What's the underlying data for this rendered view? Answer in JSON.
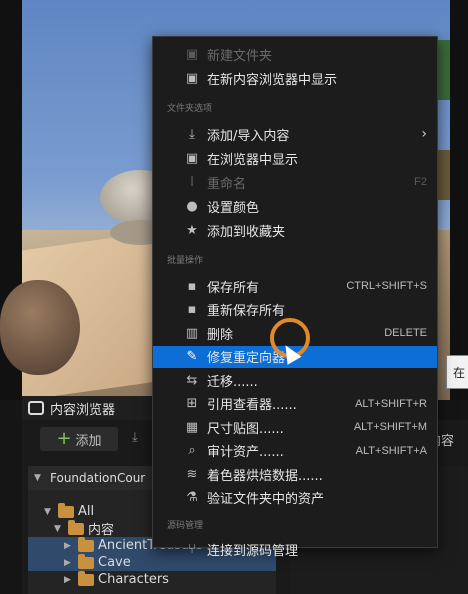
{
  "menu": {
    "top_items": [
      {
        "icon": "new-folder-icon",
        "label": "新建文件夹",
        "disabled": true
      },
      {
        "icon": "show-in-browser-icon",
        "label": "在新内容浏览器中显示",
        "disabled": false
      }
    ],
    "section_folder": "文件夹选项",
    "folder_items": [
      {
        "icon": "import-icon",
        "label": "添加/导入内容",
        "submenu": true
      },
      {
        "icon": "show-in-explorer-icon",
        "label": "在浏览器中显示"
      },
      {
        "icon": "rename-icon",
        "label": "重命名",
        "shortcut": "F2",
        "disabled": true
      },
      {
        "icon": "palette-icon",
        "label": "设置颜色"
      },
      {
        "icon": "star-icon",
        "label": "添加到收藏夹"
      }
    ],
    "section_bulk": "批量操作",
    "bulk_items": [
      {
        "icon": "save-icon",
        "label": "保存所有",
        "shortcut": "CTRL+SHIFT+S"
      },
      {
        "icon": "resave-icon",
        "label": "重新保存所有"
      },
      {
        "icon": "trash-icon",
        "label": "删除",
        "shortcut": "DELETE"
      },
      {
        "icon": "wrench-icon",
        "label": "修复重定向器",
        "highlighted": true
      },
      {
        "icon": "migrate-icon",
        "label": "迁移......"
      },
      {
        "icon": "reference-viewer-icon",
        "label": "引用查看器......",
        "shortcut": "ALT+SHIFT+R"
      },
      {
        "icon": "size-map-icon",
        "label": "尺寸贴图......",
        "shortcut": "ALT+SHIFT+M"
      },
      {
        "icon": "audit-icon",
        "label": "审计资产......",
        "shortcut": "ALT+SHIFT+A"
      },
      {
        "icon": "shader-bake-icon",
        "label": "着色器烘焙数据......"
      },
      {
        "icon": "validate-icon",
        "label": "验证文件夹中的资产"
      }
    ],
    "section_source": "源码管理",
    "source_items": [
      {
        "icon": "source-control-icon",
        "label": "连接到源码管理"
      }
    ]
  },
  "content_browser": {
    "tab_title": "内容浏览器",
    "add_button": "添加",
    "right_partial": "内容",
    "tree_header": "FoundationCour",
    "tree": [
      {
        "label": "All",
        "indent": 1,
        "open": true
      },
      {
        "label": "内容",
        "indent": 2,
        "open": true
      },
      {
        "label": "AncientTreasure",
        "indent": 3,
        "selected": true
      },
      {
        "label": "Cave",
        "indent": 3,
        "selected": true
      },
      {
        "label": "Characters",
        "indent": 3,
        "selected": false
      }
    ]
  },
  "viewport": {
    "tooltip_fragment": "在"
  },
  "colors": {
    "highlight": "#0d6fd6",
    "cursor_ring": "#e08a2b",
    "add_plus": "#7cc35b"
  }
}
